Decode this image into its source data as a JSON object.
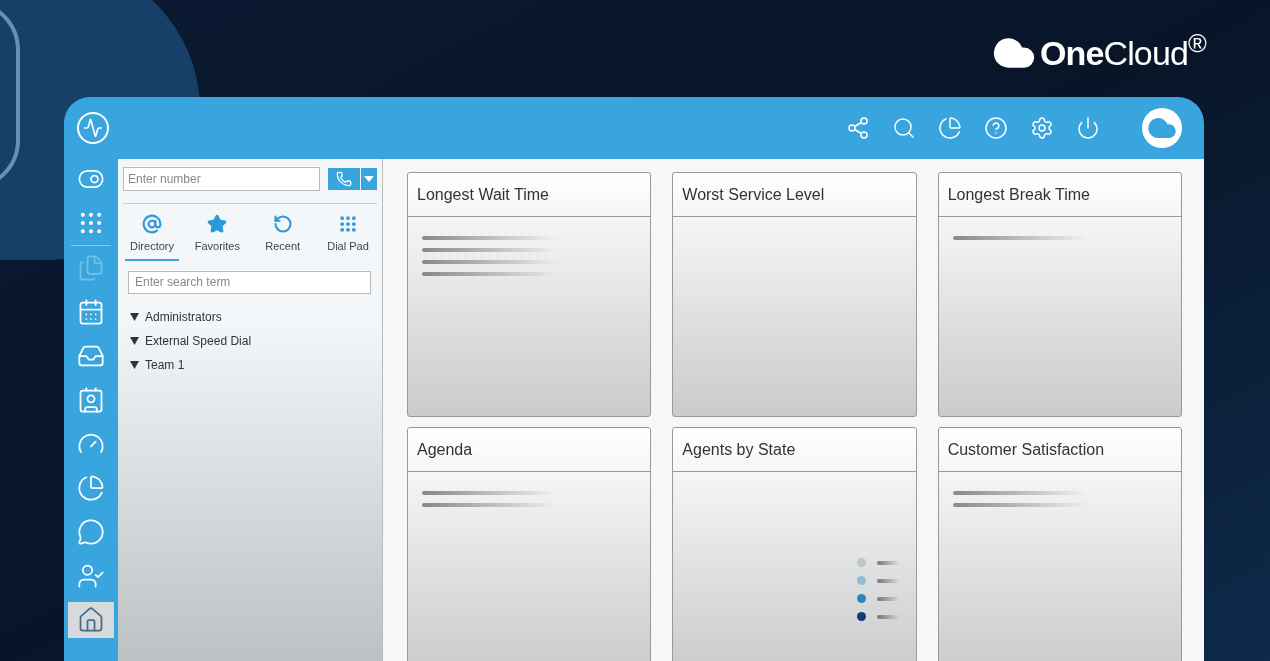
{
  "brand": {
    "logo": "**One**Cloud$^{®}$"
  },
  "header": {
    "icons": [
      {
        "kind": "share"
      },
      {
        "kind": "search"
      },
      {
        "kind": "report"
      },
      {
        "kind": "help"
      },
      {
        "kind": "settings"
      },
      {
        "kind": "power"
      }
    ]
  },
  "sidebar": {
    "items": [
      {
        "kind": "toggle",
        "selected": false,
        "disabled": false
      },
      {
        "kind": "dialpad",
        "selected": false,
        "disabled": false
      },
      {
        "kind": "documents",
        "selected": false,
        "disabled": true
      },
      {
        "kind": "calendar",
        "selected": false,
        "disabled": false
      },
      {
        "kind": "inbox",
        "selected": false,
        "disabled": false
      },
      {
        "kind": "contact",
        "selected": false,
        "disabled": false
      },
      {
        "kind": "gauge",
        "selected": false,
        "disabled": false
      },
      {
        "kind": "pie",
        "selected": false,
        "disabled": false
      },
      {
        "kind": "chat",
        "selected": false,
        "disabled": false
      },
      {
        "kind": "user-check",
        "selected": false,
        "disabled": false
      },
      {
        "kind": "home",
        "selected": true,
        "disabled": false
      }
    ]
  },
  "dialer": {
    "number_field": {
      "placeholder": "Enter number"
    },
    "tabs": [
      {
        "label": "Directory",
        "kind": "at",
        "selected": true
      },
      {
        "label": "Favorites",
        "kind": "star",
        "selected": false
      },
      {
        "label": "Recent",
        "kind": "recent",
        "selected": false
      },
      {
        "label": "Dial Pad",
        "kind": "dialpad",
        "selected": false
      }
    ],
    "search": {
      "placeholder": "Enter search term"
    },
    "tree": [
      {
        "label": "Administrators",
        "expanded": true
      },
      {
        "label": "External Speed Dial",
        "expanded": true
      },
      {
        "label": "Team 1",
        "expanded": true
      }
    ]
  },
  "cards": [
    {
      "title": "Longest Wait Time",
      "placeholder_lines": [
        {
          "kind": "line"
        },
        {
          "kind": "line"
        },
        {
          "kind": "line"
        },
        {
          "kind": "line"
        }
      ]
    },
    {
      "title": "Worst Service Level"
    },
    {
      "title": "Longest Break Time",
      "placeholder_lines": [
        {
          "kind": "line"
        }
      ]
    },
    {
      "title": "Agenda",
      "placeholder_lines": [
        {
          "kind": "line"
        },
        {
          "kind": "line"
        }
      ]
    },
    {
      "title": "Agents by State",
      "legend": [
        {
          "color": "#b9c7cc"
        },
        {
          "color": "#94bcd4"
        },
        {
          "color": "#2b87c0"
        },
        {
          "color": "#133e73"
        }
      ]
    },
    {
      "title": "Customer Satisfaction",
      "placeholder_lines": [
        {
          "kind": "line"
        },
        {
          "kind": "line"
        }
      ]
    }
  ]
}
